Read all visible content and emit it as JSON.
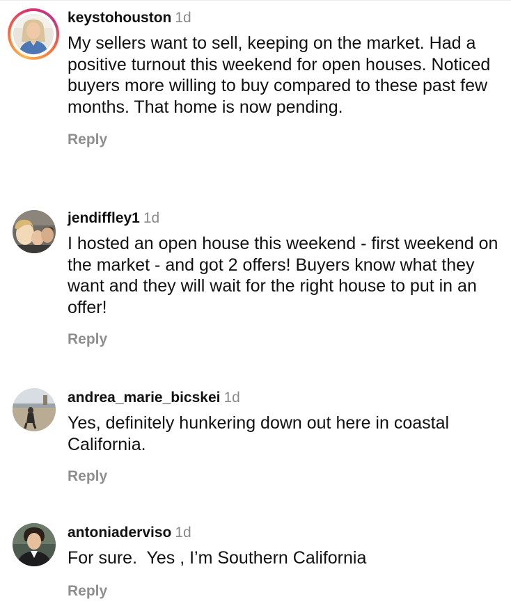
{
  "comments": [
    {
      "username": "keystohouston",
      "time": "1d",
      "text": "My sellers want to sell, keeping on the market. Had a positive turnout this weekend for open houses. Noticed buyers more willing to buy compared to these past few months. That home is now pending.",
      "reply_label": "Reply",
      "avatar_icon": "user-avatar-with-story-ring"
    },
    {
      "username": "jendiffley1",
      "time": "1d",
      "text": "I hosted an open house this weekend - first weekend on the market - and got 2 offers! Buyers know what they want and they will wait for the right house to put in an offer!",
      "reply_label": "Reply",
      "avatar_icon": "user-avatar"
    },
    {
      "username": "andrea_marie_bicskei",
      "time": "1d",
      "text": "Yes, definitely hunkering down out here in coastal California.",
      "reply_label": "Reply",
      "avatar_icon": "user-avatar"
    },
    {
      "username": "antoniaderviso",
      "time": "1d",
      "text": "For sure.  Yes , I’m Southern California",
      "reply_label": "Reply",
      "avatar_icon": "user-avatar"
    }
  ],
  "colors": {
    "username": "#111111",
    "timestamp": "#8a8a8a",
    "reply": "#8e8e8e",
    "story_ring_start": "#fdb84a",
    "story_ring_end": "#c13584"
  }
}
